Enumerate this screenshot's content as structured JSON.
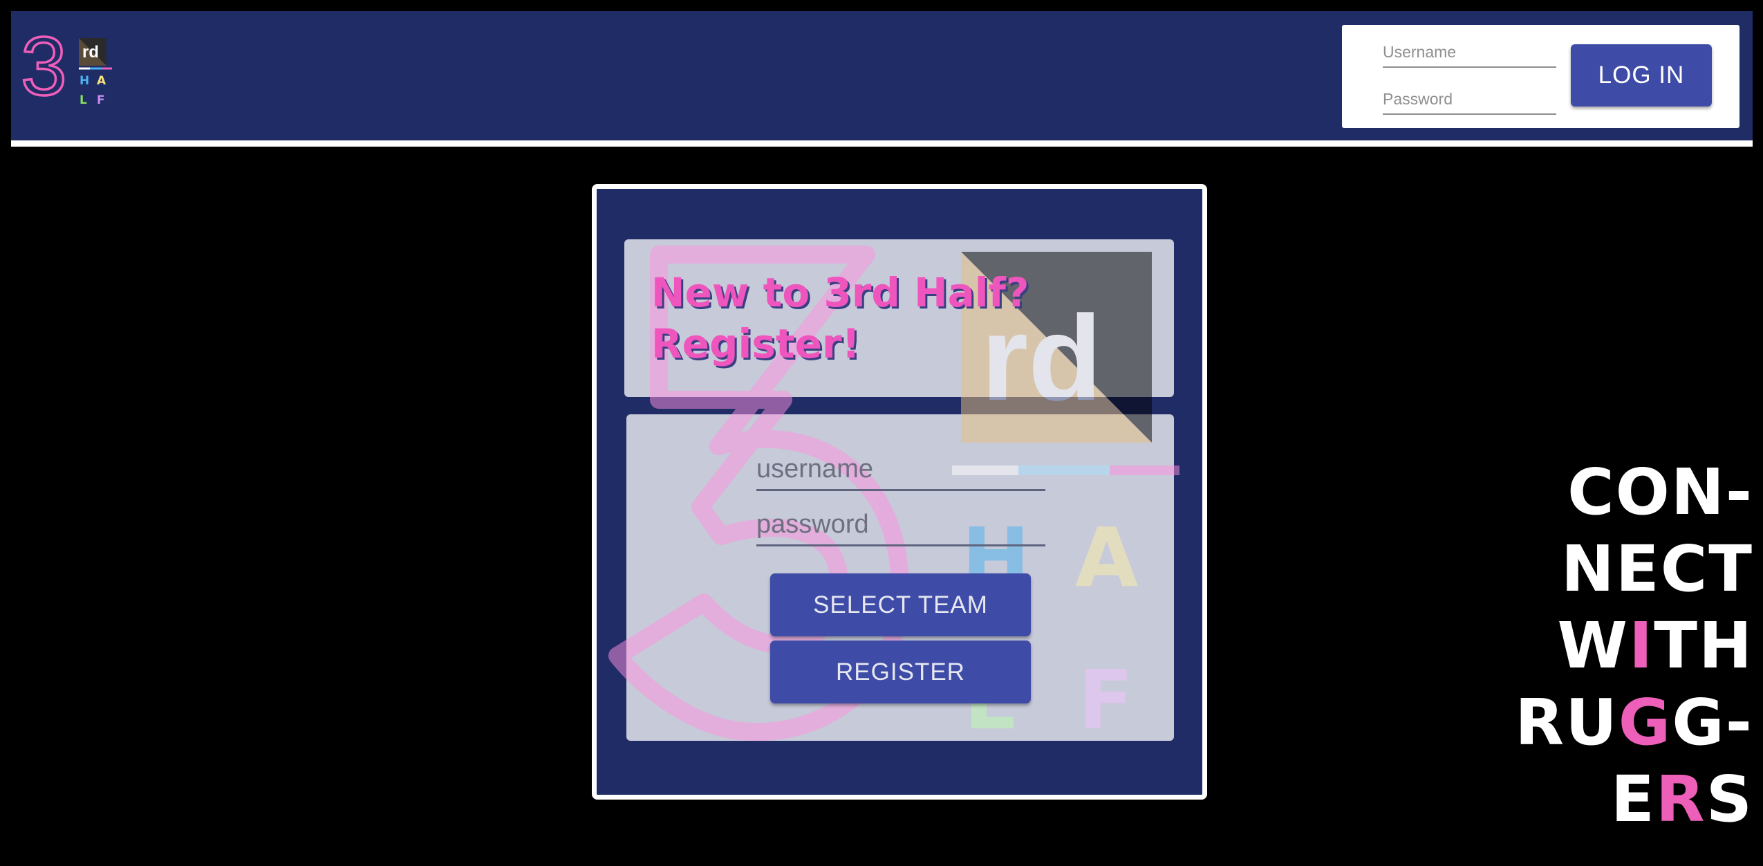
{
  "header": {
    "logo": {
      "numeral": "3",
      "superscript": "rd",
      "letters": [
        "H",
        "A",
        "L",
        "F"
      ]
    },
    "login": {
      "username_placeholder": "Username",
      "password_placeholder": "Password",
      "button_label": "LOG IN"
    }
  },
  "register": {
    "title_line1": "New to 3rd Half?",
    "title_line2": "Register!",
    "username_placeholder": "username",
    "password_placeholder": "password",
    "select_team_label": "SELECT TEAM",
    "register_label": "REGISTER"
  },
  "slogan": {
    "line1": "CON-",
    "line2": "NECT",
    "line3_a": "W",
    "line3_b": "I",
    "line3_c": "TH",
    "line4_a": "RU",
    "line4_b": "G",
    "line4_c": "G-",
    "line5_a": "E",
    "line5_b": "R",
    "line5_c": "S"
  },
  "colors": {
    "navy": "#202c66",
    "button": "#3e4ca7",
    "pink": "#ee55bd",
    "panel": "#c7cad9",
    "logo_h": "#4db3f0",
    "logo_a": "#f5e27a",
    "logo_l": "#84e05e",
    "logo_f": "#c48af0"
  }
}
